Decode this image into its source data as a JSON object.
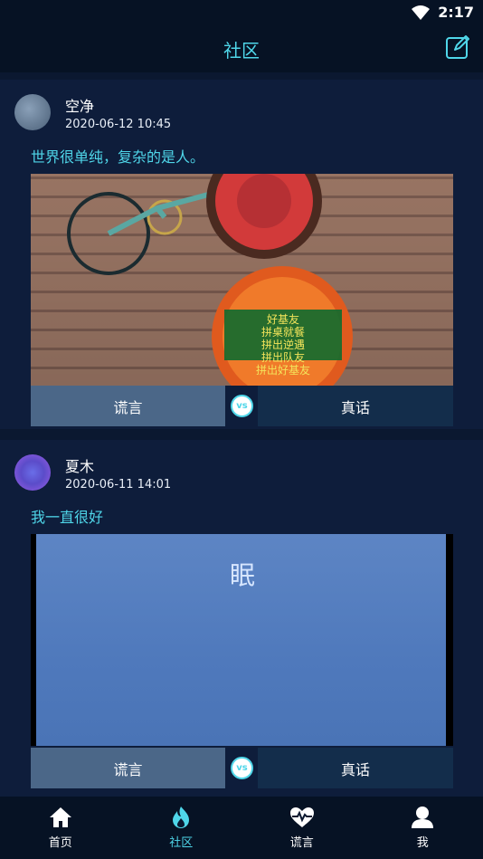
{
  "status_bar": {
    "time": "2:17"
  },
  "header": {
    "title": "社区",
    "edit_icon": "edit-icon"
  },
  "posts": [
    {
      "username": "空净",
      "timestamp": "2020-06-12 10:45",
      "text": "世界很单纯，复杂的是人。",
      "image_caption_lines": [
        "好基友",
        "拼桌就餐",
        "拼出逆遇",
        "拼出队友",
        "拼出好基友"
      ],
      "vote_left": "谎言",
      "vote_vs": "vs",
      "vote_right": "真话"
    },
    {
      "username": "夏木",
      "timestamp": "2020-06-11 14:01",
      "text": "我一直很好",
      "image_text": "眠",
      "vote_left": "谎言",
      "vote_vs": "vs",
      "vote_right": "真话"
    }
  ],
  "nav": [
    {
      "label": "首页",
      "icon": "home-icon",
      "active": false
    },
    {
      "label": "社区",
      "icon": "fire-icon",
      "active": true
    },
    {
      "label": "谎言",
      "icon": "heartbeat-icon",
      "active": false
    },
    {
      "label": "我",
      "icon": "user-icon",
      "active": false
    }
  ],
  "colors": {
    "accent": "#4fd6e9",
    "background": "#0b1830",
    "card": "#0e1d3b",
    "lie_button": "#4b6788",
    "truth_button": "#132d4b"
  }
}
